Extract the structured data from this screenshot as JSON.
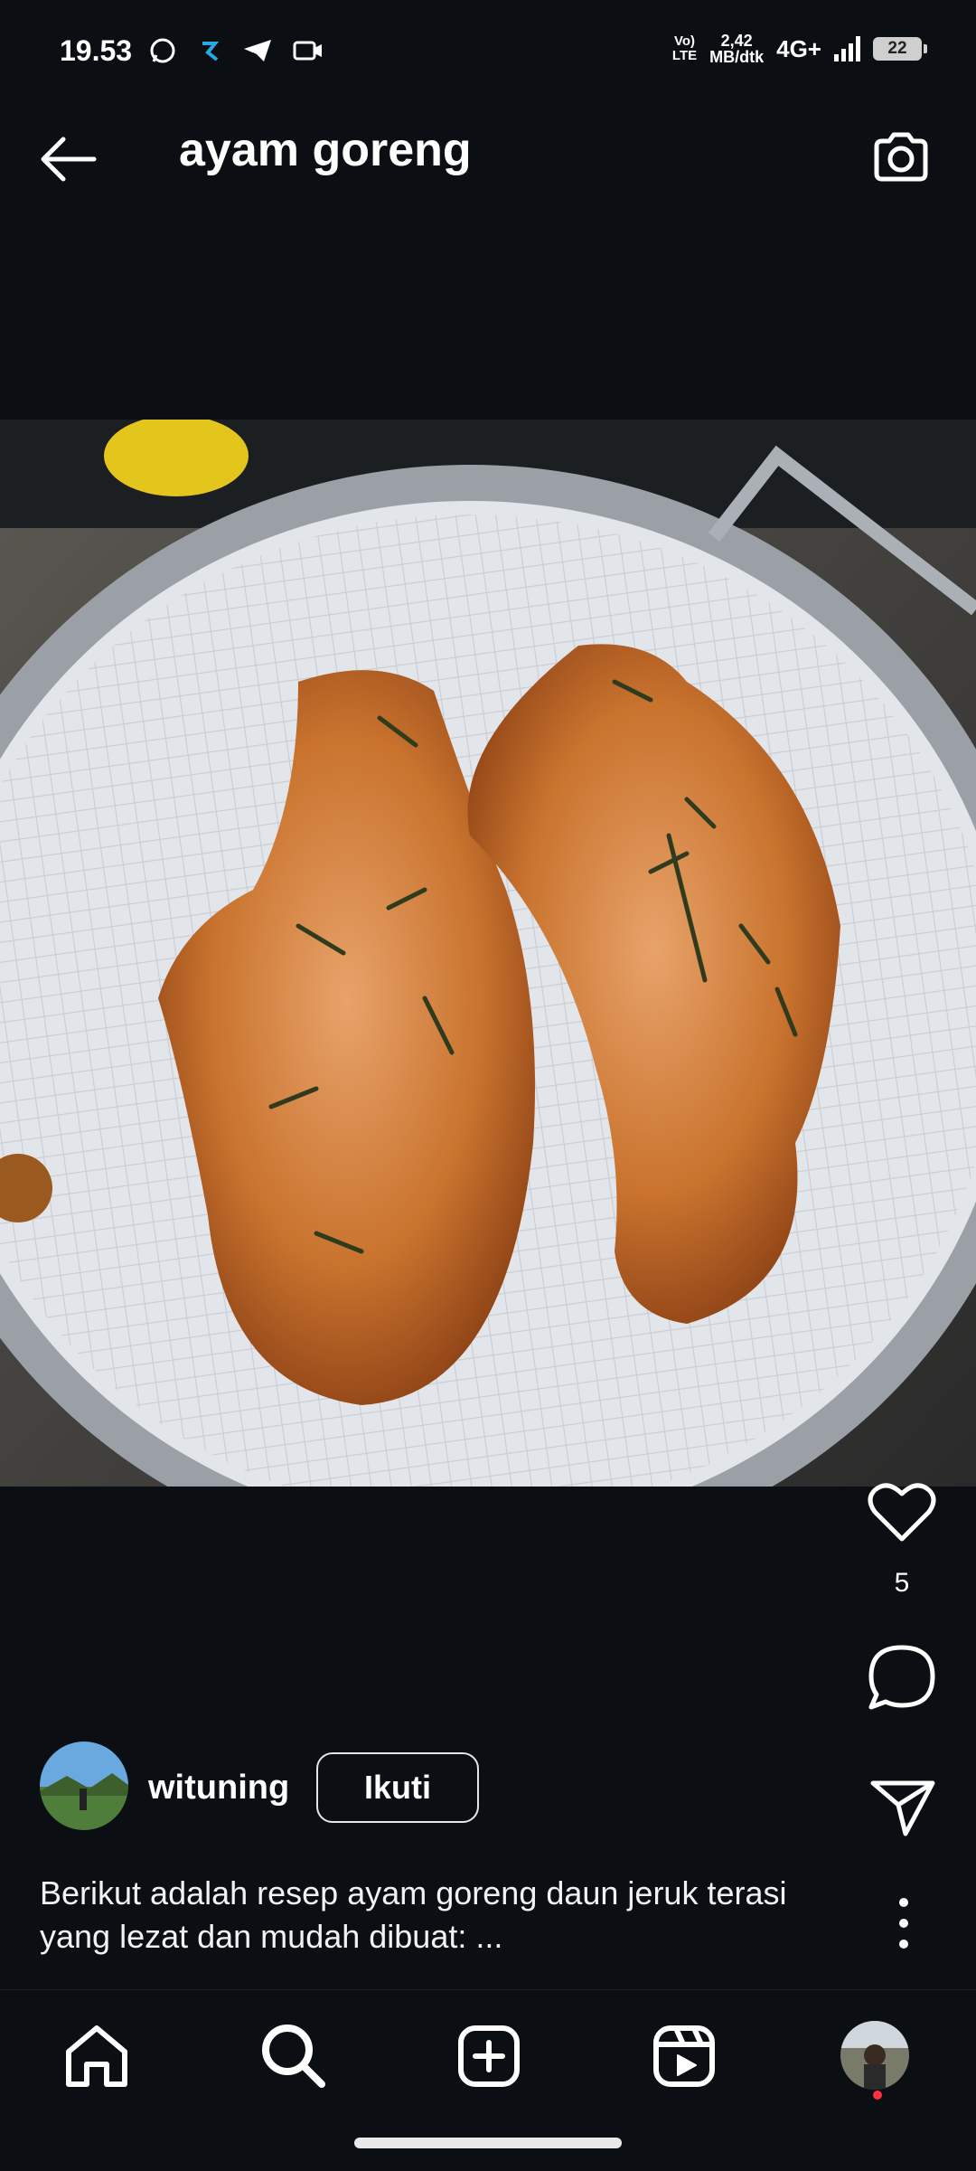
{
  "status_bar": {
    "time": "19.53",
    "volte_top": "Vo)",
    "volte_bottom": "LTE",
    "speed_top": "2,42",
    "speed_bottom": "MB/dtk",
    "network": "4G+",
    "battery": "22"
  },
  "header": {
    "title": "ayam goreng",
    "back_icon": "arrow-left-icon",
    "camera_icon": "camera-icon"
  },
  "post": {
    "photo_description_icon": "food-photo",
    "likes": "5",
    "username": "wituning",
    "follow_label": "Ikuti",
    "caption_line1": "Berikut adalah resep ayam goreng daun jeruk terasi",
    "caption_line2": "yang lezat dan mudah dibuat: ..."
  },
  "bottom_nav": {
    "items": [
      "home-icon",
      "search-icon",
      "create-icon",
      "reels-icon",
      "profile-avatar"
    ]
  }
}
